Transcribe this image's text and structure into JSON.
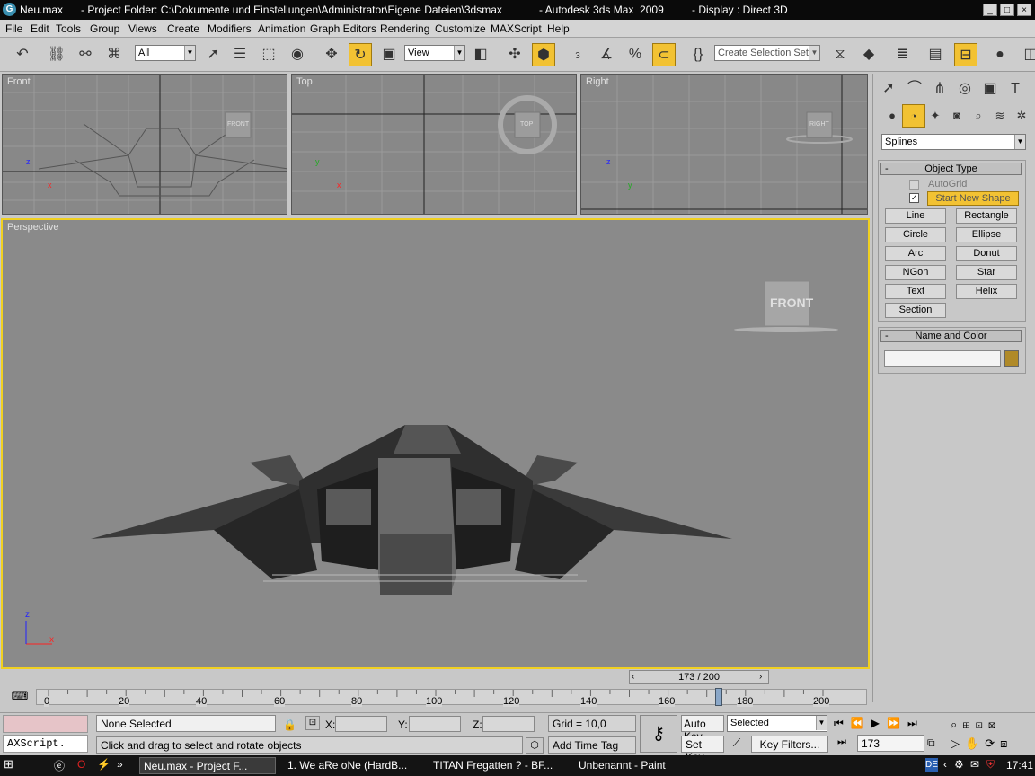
{
  "titlebar": {
    "file": "Neu.max",
    "project": "- Project Folder: C:\\Dokumente und Einstellungen\\Administrator\\Eigene Dateien\\3dsmax",
    "app": "- Autodesk 3ds Max  2009",
    "display": "- Display : Direct 3D",
    "min": "_",
    "max": "□",
    "close": "×"
  },
  "menu": [
    "File",
    "Edit",
    "Tools",
    "Group",
    "Views",
    "Create",
    "Modifiers",
    "Animation",
    "Graph Editors",
    "Rendering",
    "Customize",
    "MAXScript",
    "Help"
  ],
  "toolbar": {
    "filter_value": "All",
    "coord_value": "View",
    "selection_set_placeholder": "Create Selection Set",
    "snap_angle_label": "3"
  },
  "viewports": {
    "front": "Front",
    "top": "Top",
    "right": "Right",
    "perspective": "Perspective",
    "viewcube_front": "FRONT",
    "viewcube_top": "TOP",
    "viewcube_right": "RIGHT",
    "axis_x": "x",
    "axis_y": "y",
    "axis_z": "z"
  },
  "command_panel": {
    "category_value": "Splines",
    "object_type_header": "Object Type",
    "autogrid": "AutoGrid",
    "start_new_shape": "Start New Shape",
    "buttons": [
      "Line",
      "Rectangle",
      "Circle",
      "Ellipse",
      "Arc",
      "Donut",
      "NGon",
      "Star",
      "Text",
      "Helix",
      "Section"
    ],
    "name_color_header": "Name and Color",
    "name_value": "",
    "color": "#b08a28"
  },
  "timeline": {
    "frame_display": "173 / 200",
    "current_frame": 173,
    "total_frames": 200,
    "ticks": [
      "0",
      "20",
      "40",
      "60",
      "80",
      "100",
      "120",
      "140",
      "160",
      "180",
      "200"
    ]
  },
  "status": {
    "selection": "None Selected",
    "prompt": "Click and drag to select and rotate objects",
    "maxscript": "AXScript.",
    "x_label": "X:",
    "y_label": "Y:",
    "z_label": "Z:",
    "grid": "Grid = 10,0",
    "add_time_tag": "Add Time Tag",
    "auto_key": "Auto Key",
    "set_key": "Set Key",
    "key_mode_value": "Selected",
    "key_filters": "Key Filters...",
    "frame_value": "173"
  },
  "taskbar": {
    "tasks": [
      "Neu.max      - Project F...",
      "1. We aRe oNe (HardB...",
      "TITAN Fregatten ? - BF...",
      "Unbenannt - Paint"
    ],
    "lang": "DE",
    "clock": "17:41"
  },
  "colors": {
    "accent": "#f2c233",
    "viewport_bg": "#888888",
    "active_border": "#f0d020"
  }
}
